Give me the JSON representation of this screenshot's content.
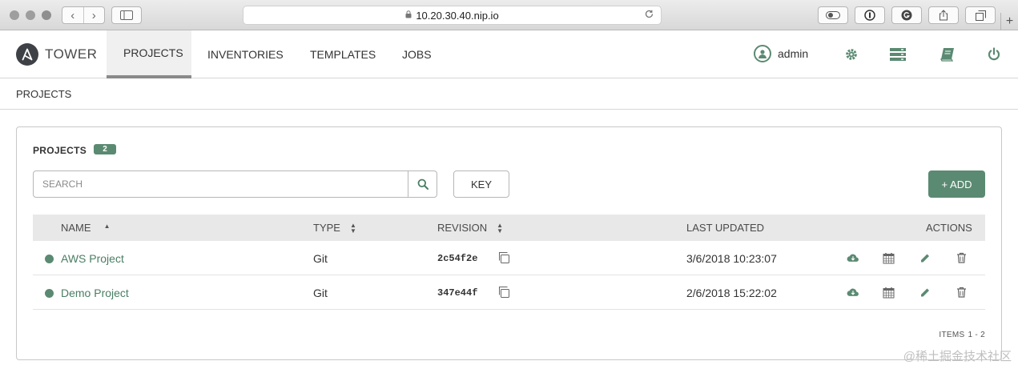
{
  "browser": {
    "url": "10.20.30.40.nip.io",
    "nav_back": "‹",
    "nav_forward": "›",
    "new_tab": "+"
  },
  "app": {
    "brand": "TOWER",
    "nav_tabs": [
      {
        "label": "PROJECTS"
      },
      {
        "label": "INVENTORIES"
      },
      {
        "label": "TEMPLATES"
      },
      {
        "label": "JOBS"
      }
    ],
    "user": "admin"
  },
  "breadcrumb": "PROJECTS",
  "panel": {
    "title": "PROJECTS",
    "count": "2",
    "search_placeholder": "SEARCH",
    "key_label": "KEY",
    "add_label": "+ ADD",
    "columns": {
      "name": "NAME",
      "type": "TYPE",
      "revision": "REVISION",
      "updated": "LAST UPDATED",
      "actions": "ACTIONS"
    },
    "rows": [
      {
        "name": "AWS Project",
        "type": "Git",
        "revision": "2c54f2e",
        "updated": "3/6/2018 10:23:07",
        "status_color": "#5b8a72"
      },
      {
        "name": "Demo Project",
        "type": "Git",
        "revision": "347e44f",
        "updated": "2/6/2018 15:22:02",
        "status_color": "#5b8a72"
      }
    ],
    "items_label": "ITEMS",
    "items_range": "1 - 2"
  },
  "watermark": "@稀土掘金技术社区",
  "colors": {
    "accent": "#5b8a72",
    "header_bg": "#e8e8e8"
  }
}
